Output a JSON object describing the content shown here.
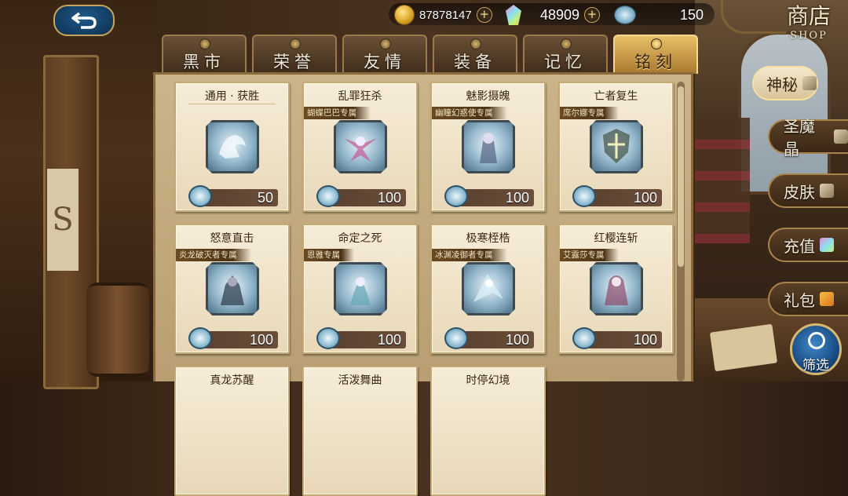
{
  "currency": {
    "gold": "87878147",
    "crystal": "48909",
    "rune": "150"
  },
  "shop_title": {
    "cn": "商店",
    "en": "SHOP"
  },
  "tabs": [
    {
      "label": "黑市",
      "active": false
    },
    {
      "label": "荣誉",
      "active": false
    },
    {
      "label": "友情",
      "active": false
    },
    {
      "label": "装备",
      "active": false
    },
    {
      "label": "记忆",
      "active": false
    },
    {
      "label": "铭刻",
      "active": true
    }
  ],
  "cards": [
    {
      "title": "通用 · 获胜",
      "owner": "",
      "price": "50"
    },
    {
      "title": "乱罪狂杀",
      "owner": "蝴蝶巴巴专属",
      "price": "100"
    },
    {
      "title": "魅影摄魄",
      "owner": "幽瞳幻惑使专属",
      "price": "100"
    },
    {
      "title": "亡者复生",
      "owner": "席尔娜专属",
      "price": "100"
    },
    {
      "title": "怒意直击",
      "owner": "炎龙破灭者专属",
      "price": "100"
    },
    {
      "title": "命定之死",
      "owner": "恩雅专属",
      "price": "100"
    },
    {
      "title": "极寒桎梏",
      "owner": "冰渊凌御者专属",
      "price": "100"
    },
    {
      "title": "红樱连斩",
      "owner": "艾露莎专属",
      "price": "100"
    },
    {
      "title": "真龙苏醒",
      "owner": "",
      "price": ""
    },
    {
      "title": "活泼舞曲",
      "owner": "",
      "price": ""
    },
    {
      "title": "时停幻境",
      "owner": "",
      "price": ""
    }
  ],
  "side_menu": [
    {
      "label": "神秘",
      "active": true
    },
    {
      "label": "圣魔晶",
      "active": false
    },
    {
      "label": "皮肤",
      "active": false
    },
    {
      "label": "充值",
      "active": false
    },
    {
      "label": "礼包",
      "active": false
    }
  ],
  "filter_label": "筛选",
  "colors": {
    "panel": "#cbb48a",
    "active_tab": "#e8c068",
    "price_bar": "#5a4030"
  }
}
